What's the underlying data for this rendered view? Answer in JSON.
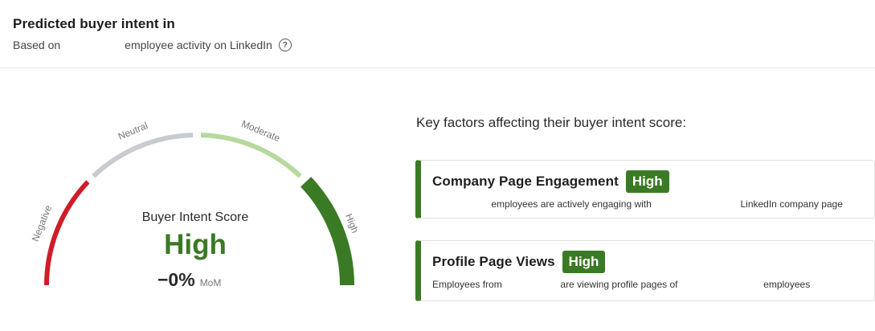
{
  "header": {
    "title": "Predicted buyer intent in",
    "subtitle_prefix": "Based on",
    "subtitle_suffix": "employee activity on LinkedIn",
    "help_icon": "?"
  },
  "gauge": {
    "segments": [
      {
        "label": "Negative",
        "color": "#d01c28"
      },
      {
        "label": "Neutral",
        "color": "#c8ccd0"
      },
      {
        "label": "Moderate",
        "color": "#b6d99d"
      },
      {
        "label": "High",
        "color": "#3a7a24"
      }
    ],
    "active": "High",
    "score_label": "Buyer Intent Score",
    "score_value": "High",
    "change_value": "−0%",
    "change_unit": "MoM"
  },
  "factors": {
    "heading": "Key factors affecting their buyer intent score:",
    "items": [
      {
        "title": "Company Page Engagement",
        "badge": "High",
        "desc_mid": "employees are actively engaging with",
        "desc_end": "LinkedIn company page"
      },
      {
        "title": "Profile Page Views",
        "badge": "High",
        "desc_start": "Employees from",
        "desc_mid": "are viewing profile pages of",
        "desc_end": "employees"
      }
    ]
  }
}
